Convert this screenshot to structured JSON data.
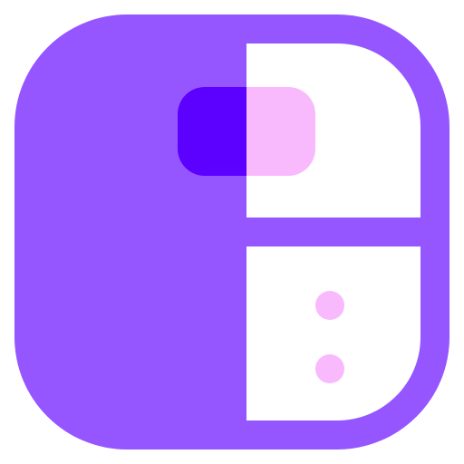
{
  "icon": {
    "name": "split-panel-app-icon",
    "colors": {
      "body": "#9656ff",
      "panel": "#ffffff",
      "tag_dark": "#5c00ff",
      "tag_light": "#f9b9fd",
      "dots": "#f9b9fd"
    }
  }
}
